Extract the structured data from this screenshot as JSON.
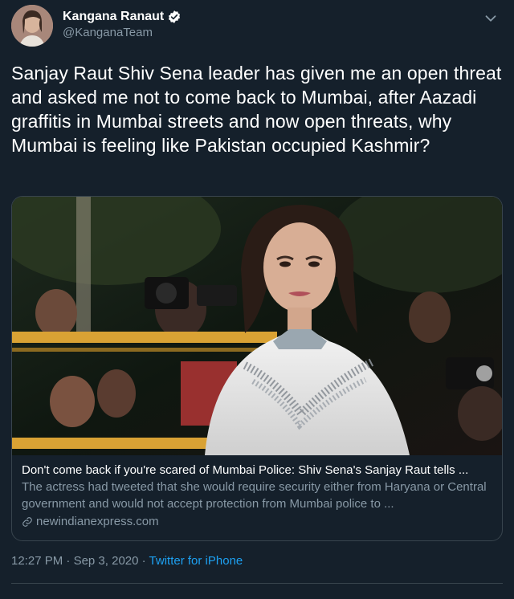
{
  "user": {
    "display_name": "Kangana Ranaut",
    "handle": "@KanganaTeam",
    "verified_icon": "verified-badge-icon",
    "menu_icon": "chevron-down-icon"
  },
  "tweet": {
    "text": "Sanjay Raut Shiv Sena leader has given me an open threat and asked me not to come back to Mumbai, after Aazadi graffitis in Mumbai streets and now open threats, why Mumbai is feeling like Pakistan occupied Kashmir?"
  },
  "card": {
    "title": "Don't come back if you're scared of Mumbai Police: Shiv Sena's Sanjay Raut tells ...",
    "description": "The actress had tweeted that she would require security either from Haryana or Central government and would not accept protection from Mumbai police to ...",
    "domain": "newindianexpress.com",
    "link_icon": "link-icon"
  },
  "footer": {
    "time": "12:27 PM",
    "separator": " · ",
    "date": "Sep 3, 2020",
    "client": "Twitter for iPhone"
  },
  "colors": {
    "background": "#15202b",
    "secondary_text": "#8899a6",
    "accent": "#1da1f2",
    "border": "#38444d"
  }
}
